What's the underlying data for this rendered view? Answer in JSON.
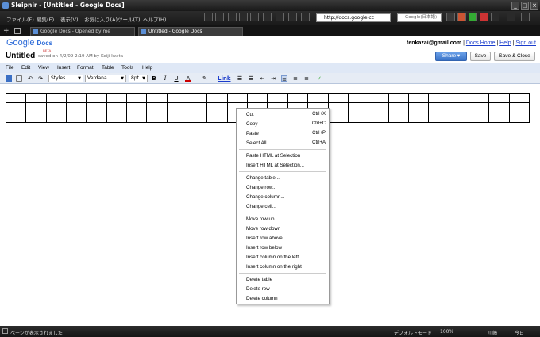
{
  "window": {
    "title": "Sleipnir - [Untitled - Google Docs]"
  },
  "menubar": {
    "items": [
      "ファイル(F)",
      "編集(E)",
      "表示(V)",
      "お気に入り(A)",
      "ツール(T)",
      "ヘルプ(H)"
    ],
    "url": "http://docs.google.cc",
    "search_placeholder": "Google(日本語)"
  },
  "tabs": [
    {
      "label": "Google Docs - Opened by me"
    },
    {
      "label": "Untitled - Google Docs"
    }
  ],
  "header": {
    "logo_google": "Google",
    "logo_docs": "Docs",
    "logo_beta": "BETA",
    "doc_title": "Untitled",
    "saved_note": "saved on 4/2/09 2:19 AM by Keiji Iwata",
    "user_email": "tenkazai@gmail.com",
    "sep": "|",
    "docs_home": "Docs Home",
    "help": "Help",
    "sign_out": "Sign out",
    "share_label": "Share ▾",
    "save_label": "Save",
    "save_close_label": "Save & Close"
  },
  "doc_menu": [
    "File",
    "Edit",
    "View",
    "Insert",
    "Format",
    "Table",
    "Tools",
    "Help"
  ],
  "format_bar": {
    "styles": "Styles",
    "font": "Verdana",
    "size": "8pt",
    "bold": "B",
    "italic": "I",
    "underline": "U",
    "textcolor": "A",
    "link": "Link"
  },
  "table": {
    "rows": 3,
    "cols": 26
  },
  "context_menu": {
    "items": [
      {
        "label": "Cut",
        "shortcut": "Ctrl+X"
      },
      {
        "label": "Copy",
        "shortcut": "Ctrl+C"
      },
      {
        "label": "Paste",
        "shortcut": "Ctrl+P"
      },
      {
        "label": "Select All",
        "shortcut": "Ctrl+A"
      },
      {
        "label": "Paste HTML at Selection",
        "shortcut": ""
      },
      {
        "label": "Insert HTML at Selection...",
        "shortcut": ""
      },
      {
        "label": "Change table...",
        "shortcut": ""
      },
      {
        "label": "Change row...",
        "shortcut": ""
      },
      {
        "label": "Change column...",
        "shortcut": ""
      },
      {
        "label": "Change cell...",
        "shortcut": ""
      },
      {
        "label": "Move row up",
        "shortcut": ""
      },
      {
        "label": "Move row down",
        "shortcut": ""
      },
      {
        "label": "Insert row above",
        "shortcut": ""
      },
      {
        "label": "Insert row below",
        "shortcut": ""
      },
      {
        "label": "Insert column on the left",
        "shortcut": ""
      },
      {
        "label": "Insert column on the right",
        "shortcut": ""
      },
      {
        "label": "Delete table",
        "shortcut": ""
      },
      {
        "label": "Delete row",
        "shortcut": ""
      },
      {
        "label": "Delete column",
        "shortcut": ""
      }
    ]
  },
  "statusbar": {
    "message": "ページが表示されました",
    "mode": "デフォルトモード",
    "zoom": "100%",
    "location": "川崎",
    "day": "今日"
  }
}
